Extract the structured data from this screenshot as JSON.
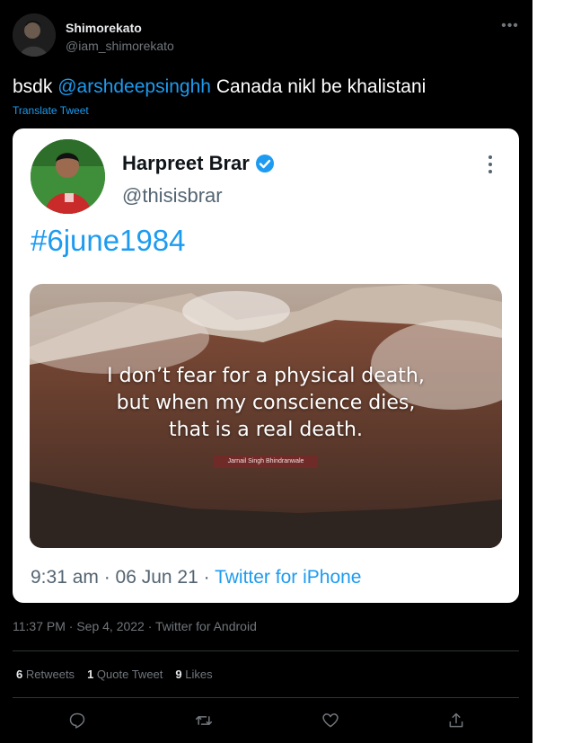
{
  "author": {
    "display_name": "Shimorekato",
    "handle": "@iam_shimorekato"
  },
  "tweet": {
    "text_before": "bsdk ",
    "mention": "@arshdeepsinghh",
    "text_after": " Canada nikl be khalistani",
    "translate_label": "Translate Tweet"
  },
  "embedded": {
    "name": "Harpreet Brar",
    "handle": "@thisisbrar",
    "hashtag": "#6june1984",
    "quote_lines": [
      "I don’t fear for a physical death,",
      "but when my conscience dies,",
      "that is a real death."
    ],
    "quote_author": "Jarnail Singh Bhindranwale",
    "time": "9:31 am · 06 Jun 21 · ",
    "source": "Twitter for iPhone"
  },
  "meta": {
    "timestamp": "11:37 PM · Sep 4, 2022 · Twitter for Android"
  },
  "stats": {
    "retweets_count": "6",
    "retweets_label": "Retweets",
    "quotes_count": "1",
    "quotes_label": "Quote Tweet",
    "likes_count": "9",
    "likes_label": "Likes"
  },
  "icons": {
    "reply": "reply-icon",
    "retweet": "retweet-icon",
    "like": "like-icon",
    "share": "share-icon"
  },
  "colors": {
    "background": "#000000",
    "accent": "#1d9bf0",
    "muted": "#71767b",
    "divider": "#2f3336"
  }
}
